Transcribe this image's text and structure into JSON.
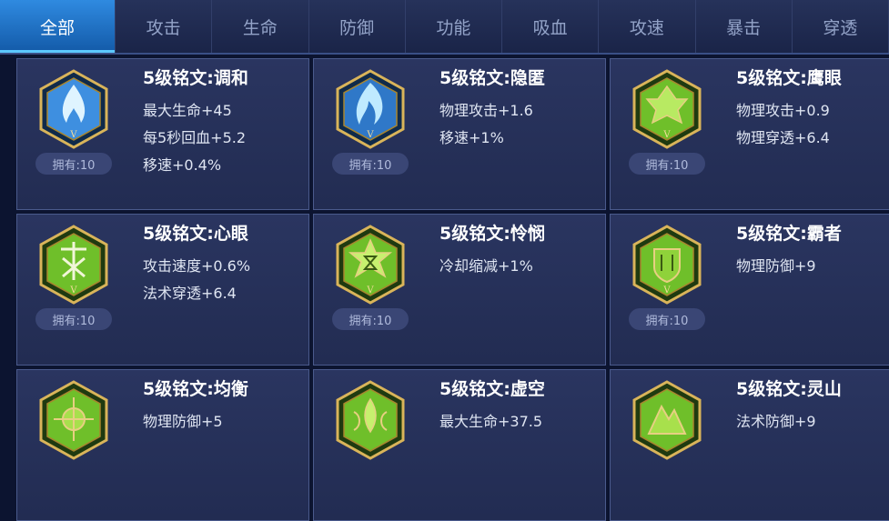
{
  "tabs": [
    {
      "label": "全部",
      "active": true
    },
    {
      "label": "攻击"
    },
    {
      "label": "生命"
    },
    {
      "label": "防御"
    },
    {
      "label": "功能"
    },
    {
      "label": "吸血"
    },
    {
      "label": "攻速"
    },
    {
      "label": "暴击"
    },
    {
      "label": "穿透"
    }
  ],
  "runes": [
    {
      "title": "5级铭文:调和",
      "stats": [
        "最大生命+45",
        "每5秒回血+5.2",
        "移速+0.4%"
      ],
      "owned": "拥有:10",
      "color": "blue",
      "icon": "flame-emblem-icon"
    },
    {
      "title": "5级铭文:隐匿",
      "stats": [
        "物理攻击+1.6",
        "移速+1%"
      ],
      "owned": "拥有:10",
      "color": "blue",
      "icon": "flame-emblem-icon"
    },
    {
      "title": "5级铭文:鹰眼",
      "stats": [
        "物理攻击+0.9",
        "物理穿透+6.4"
      ],
      "owned": "拥有:10",
      "color": "green",
      "icon": "eagle-emblem-icon"
    },
    {
      "title": "5级铭文:心眼",
      "stats": [
        "攻击速度+0.6%",
        "法术穿透+6.4"
      ],
      "owned": "拥有:10",
      "color": "green",
      "icon": "heart-emblem-icon"
    },
    {
      "title": "5级铭文:怜悯",
      "stats": [
        "冷却缩减+1%"
      ],
      "owned": "拥有:10",
      "color": "green",
      "icon": "star-emblem-icon"
    },
    {
      "title": "5级铭文:霸者",
      "stats": [
        "物理防御+9"
      ],
      "owned": "拥有:10",
      "color": "green",
      "icon": "shield-emblem-icon"
    },
    {
      "title": "5级铭文:均衡",
      "stats": [
        "物理防御+5"
      ],
      "owned": "",
      "color": "green",
      "icon": "balance-emblem-icon"
    },
    {
      "title": "5级铭文:虚空",
      "stats": [
        "最大生命+37.5"
      ],
      "owned": "",
      "color": "green",
      "icon": "void-emblem-icon"
    },
    {
      "title": "5级铭文:灵山",
      "stats": [
        "法术防御+9"
      ],
      "owned": "",
      "color": "green",
      "icon": "mountain-emblem-icon"
    }
  ],
  "colors": {
    "active_tab": "#1f74c8",
    "blue_rune": "#3e8fe0",
    "green_rune": "#6fbf2a",
    "gold_frame": "#d9b45a"
  }
}
